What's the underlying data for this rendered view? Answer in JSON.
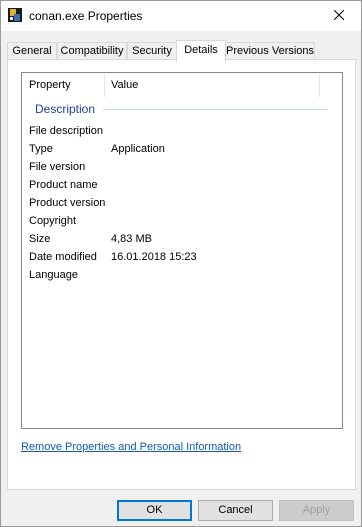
{
  "window": {
    "title": "conan.exe Properties",
    "icon": "executable-file-icon",
    "close_icon": "close-icon"
  },
  "tabs": [
    {
      "label": "General",
      "active": false
    },
    {
      "label": "Compatibility",
      "active": false
    },
    {
      "label": "Security",
      "active": false
    },
    {
      "label": "Details",
      "active": true
    },
    {
      "label": "Previous Versions",
      "active": false
    }
  ],
  "details": {
    "columns": {
      "property": "Property",
      "value": "Value"
    },
    "group": "Description",
    "rows": [
      {
        "name": "File description",
        "value": ""
      },
      {
        "name": "Type",
        "value": "Application"
      },
      {
        "name": "File version",
        "value": ""
      },
      {
        "name": "Product name",
        "value": ""
      },
      {
        "name": "Product version",
        "value": ""
      },
      {
        "name": "Copyright",
        "value": ""
      },
      {
        "name": "Size",
        "value": "4,83 MB"
      },
      {
        "name": "Date modified",
        "value": "16.01.2018 15:23"
      },
      {
        "name": "Language",
        "value": ""
      }
    ]
  },
  "link": "Remove Properties and Personal Information",
  "buttons": {
    "ok": "OK",
    "cancel": "Cancel",
    "apply": "Apply"
  },
  "colors": {
    "group_label": "#1e3e9c",
    "link": "#0f5bb8",
    "default_button_border": "#0078d7"
  }
}
